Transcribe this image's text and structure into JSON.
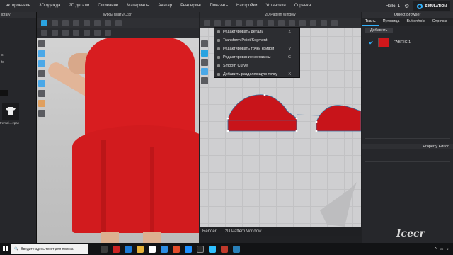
{
  "menubar": {
    "items": [
      "актирование",
      "3D одежда",
      "2D детали",
      "Сшивание",
      "Материалы",
      "Аватар",
      "Рендеринг",
      "Показать",
      "Настройки",
      "Установки",
      "Справка"
    ],
    "user": "Hello, 1",
    "simulation_label": "SIMULATION"
  },
  "library": {
    "title": "ibrary",
    "marks": [
      "s",
      "ts"
    ],
    "thumbnail_label": "Femal....zpac"
  },
  "viewport": {
    "title": "курсы платья.Zprj",
    "tab_label": "Render"
  },
  "pattern_window": {
    "title": "2D Pattern Window",
    "tab_label": "2D Pattern Window",
    "context_menu": [
      {
        "label": "Редактировать деталь",
        "key": "Z"
      },
      {
        "label": "Transform Point/Segment",
        "key": ""
      },
      {
        "label": "Редактировать точки кривой",
        "key": "V"
      },
      {
        "label": "Редактирование кривизны",
        "key": "C"
      },
      {
        "label": "Smooth Curve",
        "key": ""
      },
      {
        "label": "Добавить разделяющую точку",
        "key": "X"
      }
    ]
  },
  "object_browser": {
    "title": "Object Browser",
    "tabs": [
      "Ткань",
      "Пуговица",
      "Buttonhole",
      "Строчка"
    ],
    "add_label": "Добавить",
    "fabric_name": "FABRIC 1",
    "fabric_color": "#d0171b",
    "property_title": "Property Editor"
  },
  "taskbar": {
    "search_placeholder": "Введите здесь текст для поиска"
  },
  "watermark": "Icecr"
}
